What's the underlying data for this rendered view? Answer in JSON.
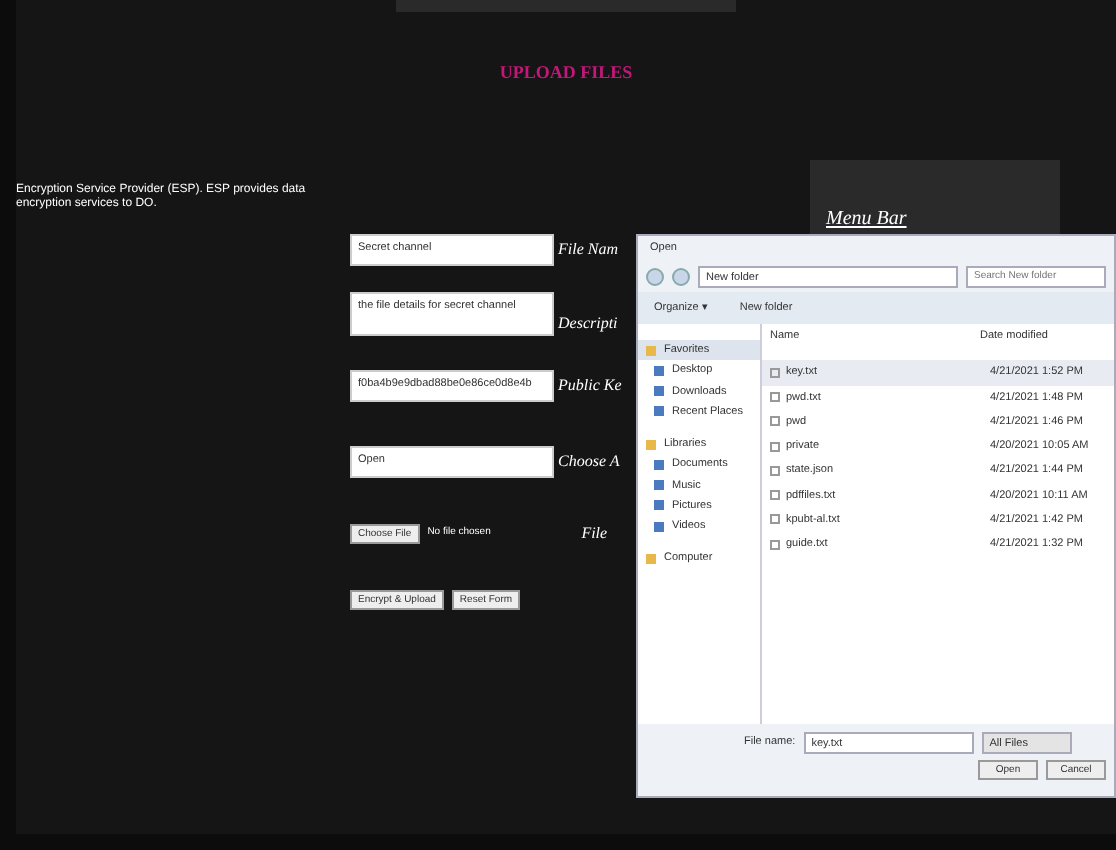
{
  "page": {
    "title": "UPLOAD FILES",
    "intro": "Encryption Service Provider (ESP). ESP provides data encryption services to DO.",
    "menu_title": "Menu Bar"
  },
  "form": {
    "fields": [
      {
        "kind": "text",
        "value": "Secret channel",
        "label": "File Nam"
      },
      {
        "kind": "textarea",
        "value": "the file details for secret channel",
        "label": "Descripti"
      },
      {
        "kind": "text",
        "value": "f0ba4b9e9dbad88be0e86ce0d8e4b",
        "label": "Public Ke"
      },
      {
        "kind": "select",
        "value": "Open",
        "label": "Choose A"
      },
      {
        "kind": "file",
        "button": "Choose File",
        "status": "No file chosen",
        "label": "File"
      }
    ],
    "buttons": [
      "Encrypt & Upload",
      "Reset Form"
    ]
  },
  "dialog": {
    "title": "Open",
    "path": "New folder",
    "search_placeholder": "Search New folder",
    "toolbar": [
      "Organize ▾",
      "New folder"
    ],
    "nav": [
      {
        "label": "Favorites",
        "selected": true,
        "children": [
          {
            "label": "Desktop",
            "selected": false
          },
          {
            "label": "Downloads",
            "selected": false
          },
          {
            "label": "Recent Places",
            "selected": false
          }
        ]
      },
      {
        "label": "Libraries",
        "selected": false,
        "children": [
          {
            "label": "Documents",
            "selected": false
          },
          {
            "label": "Music",
            "selected": false
          },
          {
            "label": "Pictures",
            "selected": false
          },
          {
            "label": "Videos",
            "selected": false
          }
        ]
      },
      {
        "label": "Computer",
        "selected": false
      }
    ],
    "columns": [
      "Name",
      "Date modified"
    ],
    "files": [
      {
        "name": "key.txt",
        "date": "4/21/2021 1:52 PM",
        "selected": true
      },
      {
        "name": "pwd.txt",
        "date": "4/21/2021 1:48 PM",
        "selected": false
      },
      {
        "name": "pwd",
        "date": "4/21/2021 1:46 PM",
        "selected": false
      },
      {
        "name": "private",
        "date": "4/20/2021 10:05 AM",
        "selected": false
      },
      {
        "name": "state.json",
        "date": "4/21/2021 1:44 PM",
        "selected": false
      },
      {
        "name": "pdffiles.txt",
        "date": "4/20/2021 10:11 AM",
        "selected": false
      },
      {
        "name": "kpubt-al.txt",
        "date": "4/21/2021 1:42 PM",
        "selected": false
      },
      {
        "name": "guide.txt",
        "date": "4/21/2021 1:32 PM",
        "selected": false
      }
    ],
    "file_name_label": "File name:",
    "file_name": "key.txt",
    "file_type": "All Files",
    "buttons": [
      "Open",
      "Cancel"
    ]
  }
}
